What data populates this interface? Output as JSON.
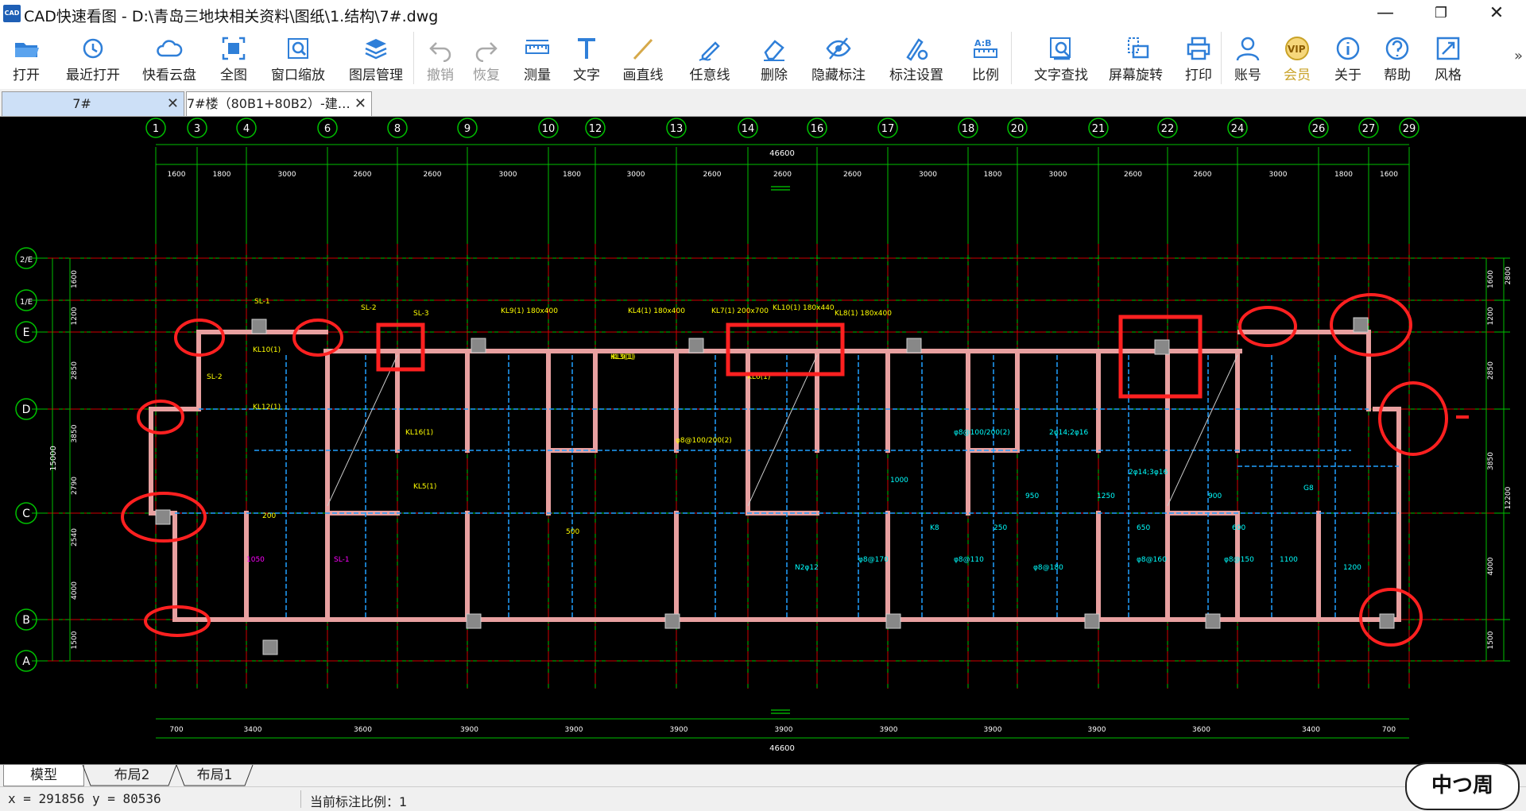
{
  "window": {
    "app_logo": "CAD",
    "title": "CAD快速看图 - D:\\青岛三地块相关资料\\图纸\\1.结构\\7#.dwg",
    "minimize": "—",
    "restore": "❐",
    "close": "✕"
  },
  "toolbar": [
    {
      "label": "打开",
      "icon": "folder-open-icon",
      "enabled": true
    },
    {
      "label": "最近打开",
      "icon": "clock-history-icon",
      "enabled": true
    },
    {
      "label": "快看云盘",
      "icon": "cloud-icon",
      "enabled": true
    },
    {
      "label": "全图",
      "icon": "fit-screen-icon",
      "enabled": true
    },
    {
      "label": "窗口缩放",
      "icon": "zoom-window-icon",
      "enabled": true
    },
    {
      "label": "图层管理",
      "icon": "layers-icon",
      "enabled": true
    },
    {
      "label": "撤销",
      "icon": "undo-icon",
      "enabled": false
    },
    {
      "label": "恢复",
      "icon": "redo-icon",
      "enabled": false
    },
    {
      "label": "测量",
      "icon": "ruler-icon",
      "enabled": true
    },
    {
      "label": "文字",
      "icon": "text-icon",
      "enabled": true
    },
    {
      "label": "画直线",
      "icon": "line-icon",
      "enabled": true
    },
    {
      "label": "任意线",
      "icon": "pen-icon",
      "enabled": true
    },
    {
      "label": "删除",
      "icon": "eraser-icon",
      "enabled": true
    },
    {
      "label": "隐藏标注",
      "icon": "eye-hide-icon",
      "enabled": true
    },
    {
      "label": "标注设置",
      "icon": "annotation-settings-icon",
      "enabled": true
    },
    {
      "label": "比例",
      "icon": "scale-ratio-icon",
      "enabled": true
    },
    {
      "label": "文字查找",
      "icon": "text-search-icon",
      "enabled": true
    },
    {
      "label": "屏幕旋转",
      "icon": "rotate-screen-icon",
      "enabled": true
    },
    {
      "label": "打印",
      "icon": "printer-icon",
      "enabled": true
    },
    {
      "label": "账号",
      "icon": "user-icon",
      "enabled": true
    },
    {
      "label": "会员",
      "icon": "vip-icon",
      "enabled": true
    },
    {
      "label": "关于",
      "icon": "info-icon",
      "enabled": true
    },
    {
      "label": "帮助",
      "icon": "help-icon",
      "enabled": true
    },
    {
      "label": "风格",
      "icon": "style-icon",
      "enabled": true
    }
  ],
  "toolbar_more": "»",
  "tabs": [
    {
      "label": "7#",
      "active": true,
      "close": "✕"
    },
    {
      "label": "7#楼（80B1+80B2）-建…",
      "active": false,
      "close": "✕"
    }
  ],
  "drawing": {
    "axis_labels": [
      "1",
      "3",
      "4",
      "6",
      "8",
      "9",
      "10",
      "12",
      "13",
      "14",
      "16",
      "17",
      "18",
      "20",
      "21",
      "22",
      "24",
      "26",
      "27",
      "29"
    ],
    "row_labels": [
      "2/E",
      "1/E",
      "E",
      "D",
      "C",
      "B",
      "A"
    ],
    "top_dims": [
      "1600",
      "1800",
      "3000",
      "2600",
      "2600",
      "3000",
      "1800",
      "3000",
      "2600",
      "2600",
      "2600",
      "3000",
      "1800",
      "3000",
      "2600",
      "2600",
      "3000",
      "1800",
      "1600"
    ],
    "top_total": "46600",
    "bottom_dims": [
      "700",
      "3400",
      "3600",
      "3900",
      "3900",
      "3900",
      "3900",
      "3900",
      "3900",
      "3900",
      "3600",
      "3400",
      "700"
    ],
    "bottom_total": "46600",
    "left_dims": [
      "1600",
      "1200",
      "2850",
      "3850",
      "2790",
      "2540",
      "4000",
      "1500"
    ],
    "left_total": "15000",
    "right_dims": [
      "1600",
      "1200",
      "2850",
      "3850",
      "4000",
      "1500"
    ],
    "right_totals": [
      "2800",
      "12200"
    ],
    "annotations": [
      "SL-1",
      "SL-2",
      "SL-3",
      "KL9(1) 180x400",
      "KL4(1) 180x400",
      "KL7(1) 200x700",
      "KL10(1) 180x440",
      "KL8(1) 180x400",
      "KL10(1)",
      "KL9(1)",
      "KL12(1)",
      "KL16(1)",
      "KL5(1)",
      "KL3(1)",
      "KL6(1)",
      "φ8@100/200(2)",
      "φ8@100/200(2)",
      "2φ14;2φ16",
      "2φ14;3φ16",
      "N2φ12",
      "φ8@170",
      "φ8@110",
      "φ8@180",
      "φ8@160",
      "φ8@150",
      "1100",
      "1200",
      "1000",
      "950",
      "1250",
      "900",
      "G8",
      "K8",
      "250",
      "650",
      "600",
      "200",
      "500",
      "1050"
    ]
  },
  "layout_tabs": [
    {
      "label": "模型",
      "active": true
    },
    {
      "label": "布局2",
      "active": false
    },
    {
      "label": "布局1",
      "active": false
    }
  ],
  "status": {
    "coords": "x = 291856 y = 80536",
    "scale_text": "当前标注比例：1"
  },
  "watermark": "中つ周"
}
